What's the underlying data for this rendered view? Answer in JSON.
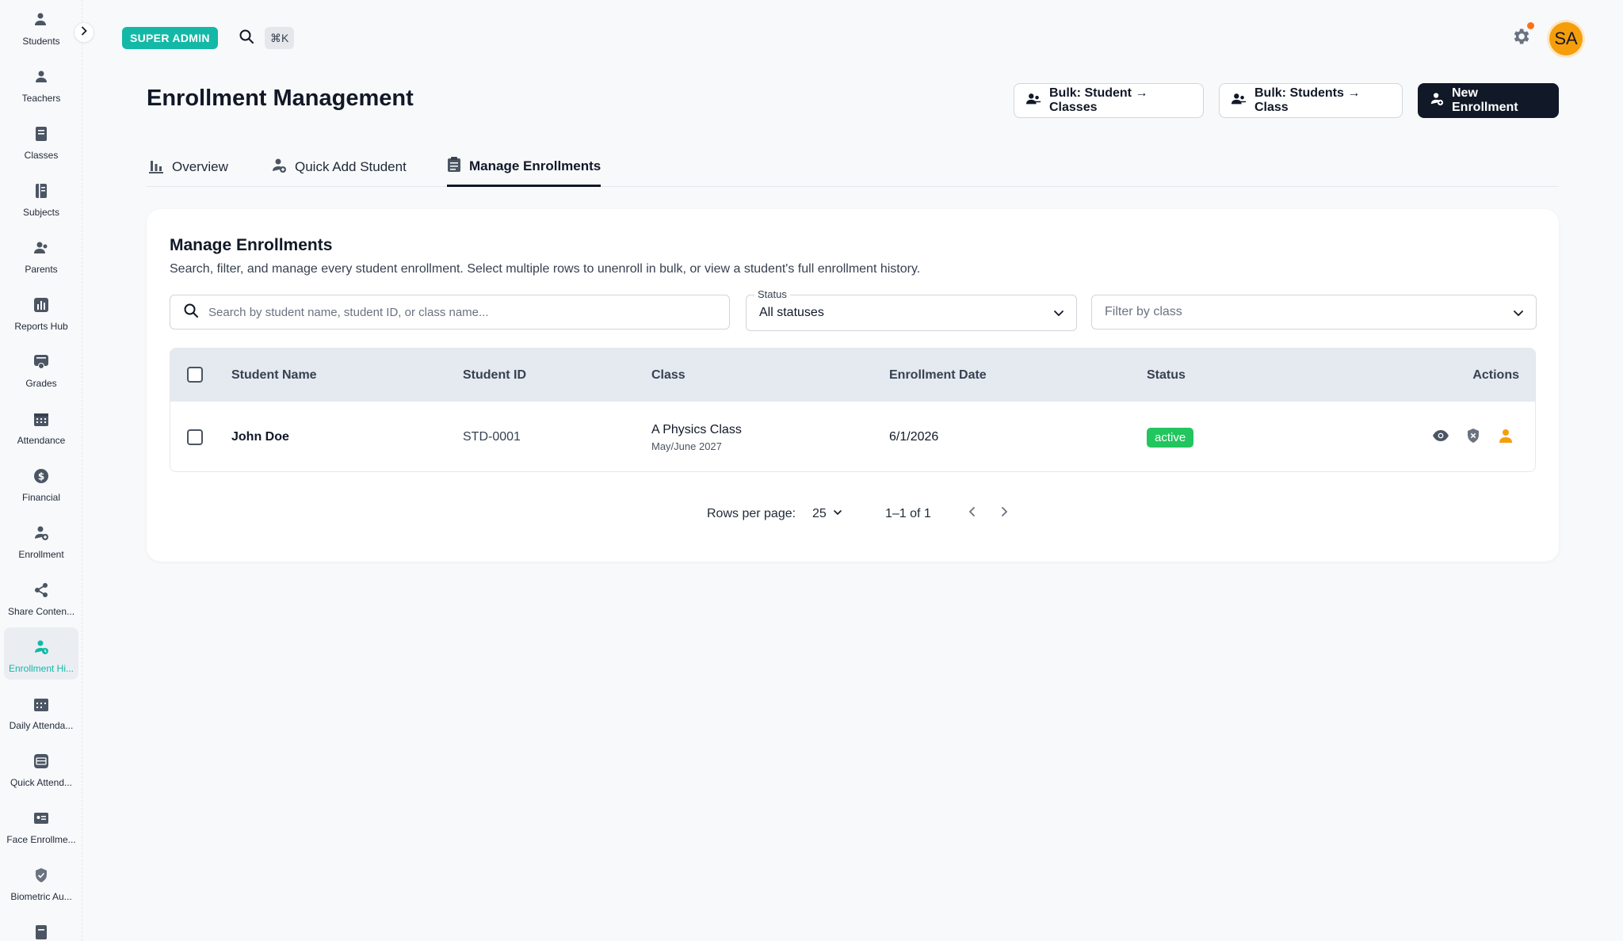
{
  "sidebar": {
    "items": [
      {
        "label": "Students",
        "icon": "user-group-icon"
      },
      {
        "label": "Teachers",
        "icon": "teacher-icon"
      },
      {
        "label": "Classes",
        "icon": "book-icon"
      },
      {
        "label": "Subjects",
        "icon": "notebook-icon"
      },
      {
        "label": "Parents",
        "icon": "parents-icon"
      },
      {
        "label": "Reports Hub",
        "icon": "bar-chart-icon"
      },
      {
        "label": "Grades",
        "icon": "grades-icon"
      },
      {
        "label": "Attendance",
        "icon": "calendar-icon"
      },
      {
        "label": "Financial",
        "icon": "dollar-icon"
      },
      {
        "label": "Enrollment",
        "icon": "user-add-icon"
      },
      {
        "label": "Share Conten...",
        "icon": "share-icon"
      },
      {
        "label": "Enrollment Hi...",
        "icon": "user-history-icon"
      },
      {
        "label": "Daily Attenda...",
        "icon": "calendar-days-icon"
      },
      {
        "label": "Quick Attend...",
        "icon": "quick-attendance-icon"
      },
      {
        "label": "Face Enrollme...",
        "icon": "id-card-icon"
      },
      {
        "label": "Biometric Au...",
        "icon": "shield-check-icon"
      }
    ],
    "active_index": 11,
    "accent": "#14b8a6"
  },
  "topbar": {
    "role_badge": "SUPER ADMIN",
    "shortcut": "⌘K",
    "avatar_initials": "SA"
  },
  "header": {
    "title": "Enrollment Management",
    "buttons": {
      "bulk_student_classes": "Bulk: Student → Classes",
      "bulk_students_class": "Bulk: Students → Class",
      "new_enrollment": "New Enrollment"
    }
  },
  "tabs": [
    {
      "label": "Overview"
    },
    {
      "label": "Quick Add Student"
    },
    {
      "label": "Manage Enrollments"
    }
  ],
  "card": {
    "title": "Manage Enrollments",
    "description": "Search, filter, and manage every student enrollment. Select multiple rows to unenroll in bulk, or view a student's full enrollment history.",
    "search_placeholder": "Search by student name, student ID, or class name...",
    "status_label": "Status",
    "status_value": "All statuses",
    "class_filter_placeholder": "Filter by class"
  },
  "table": {
    "columns": [
      "Student Name",
      "Student ID",
      "Class",
      "Enrollment Date",
      "Status",
      "Actions"
    ],
    "rows": [
      {
        "student_name": "John Doe",
        "student_id": "STD-0001",
        "class_name": "A Physics Class",
        "class_session": "May/June 2027",
        "enrollment_date": "6/1/2026",
        "status": "active"
      }
    ],
    "status_color": "#22c55e"
  },
  "pagination": {
    "rows_per_page_label": "Rows per page:",
    "rows_per_page": "25",
    "range": "1–1 of 1"
  }
}
